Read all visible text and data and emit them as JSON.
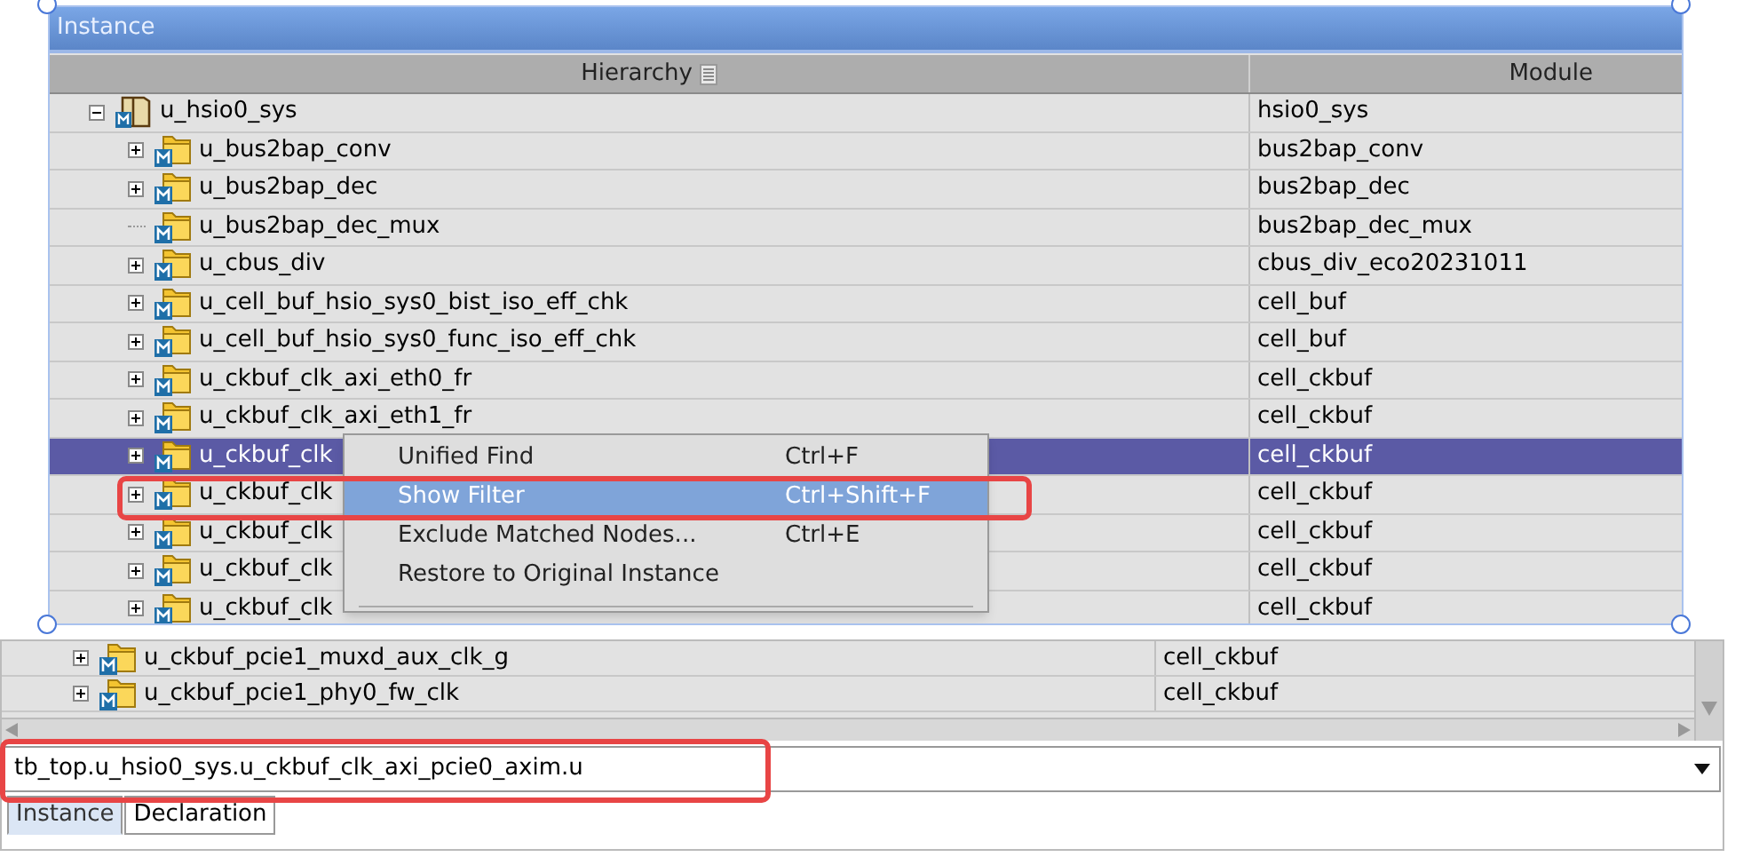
{
  "panel": {
    "title": "Instance",
    "columns": [
      "Hierarchy",
      "Module"
    ],
    "tree": [
      {
        "kind": "root",
        "name": "u_hsio0_sys",
        "module": "hsio0_sys",
        "expanded": true,
        "selected": false,
        "children": [
          {
            "kind": "branch",
            "name": "u_bus2bap_conv",
            "module": "bus2bap_conv",
            "expanded": false,
            "selected": false
          },
          {
            "kind": "branch",
            "name": "u_bus2bap_dec",
            "module": "bus2bap_dec",
            "expanded": false,
            "selected": false
          },
          {
            "kind": "leaf",
            "name": "u_bus2bap_dec_mux",
            "module": "bus2bap_dec_mux",
            "selected": false
          },
          {
            "kind": "branch",
            "name": "u_cbus_div",
            "module": "cbus_div_eco20231011",
            "expanded": false,
            "selected": false
          },
          {
            "kind": "branch",
            "name": "u_cell_buf_hsio_sys0_bist_iso_eff_chk",
            "module": "cell_buf",
            "expanded": false,
            "selected": false
          },
          {
            "kind": "branch",
            "name": "u_cell_buf_hsio_sys0_func_iso_eff_chk",
            "module": "cell_buf",
            "expanded": false,
            "selected": false
          },
          {
            "kind": "branch",
            "name": "u_ckbuf_clk_axi_eth0_fr",
            "module": "cell_ckbuf",
            "expanded": false,
            "selected": false
          },
          {
            "kind": "branch",
            "name": "u_ckbuf_clk_axi_eth1_fr",
            "module": "cell_ckbuf",
            "expanded": false,
            "selected": false
          },
          {
            "kind": "branch",
            "name": "u_ckbuf_clk",
            "module": "cell_ckbuf",
            "expanded": false,
            "selected": true
          },
          {
            "kind": "branch",
            "name": "u_ckbuf_clk",
            "module": "cell_ckbuf",
            "expanded": false,
            "selected": false
          },
          {
            "kind": "branch",
            "name": "u_ckbuf_clk",
            "module": "cell_ckbuf",
            "expanded": false,
            "selected": false
          },
          {
            "kind": "branch",
            "name": "u_ckbuf_clk",
            "module": "cell_ckbuf",
            "expanded": false,
            "selected": false
          },
          {
            "kind": "branch",
            "name": "u_ckbuf_clk",
            "module": "cell_ckbuf",
            "expanded": false,
            "selected": false
          }
        ]
      }
    ]
  },
  "context_menu": [
    {
      "label": "Unified Find",
      "shortcut": "Ctrl+F",
      "selected": false
    },
    {
      "label": "Show Filter",
      "shortcut": "Ctrl+Shift+F",
      "selected": true
    },
    {
      "label": "Exclude Matched Nodes...",
      "shortcut": "Ctrl+E",
      "selected": false
    },
    {
      "label": "Restore to Original Instance",
      "selected": false
    }
  ],
  "lower": {
    "rows": [
      {
        "name": "u_ckbuf_pcie1_muxd_aux_clk_g",
        "module": "cell_ckbuf"
      },
      {
        "name": "u_ckbuf_pcie1_phy0_fw_clk",
        "module": "cell_ckbuf"
      }
    ],
    "path_field": {
      "value": "tb_top.u_hsio0_sys.u_ckbuf_clk_axi_pcie0_axim.u"
    },
    "tabs": [
      {
        "label": "Instance",
        "selected": true
      },
      {
        "label": "Declaration",
        "selected": false
      }
    ]
  }
}
